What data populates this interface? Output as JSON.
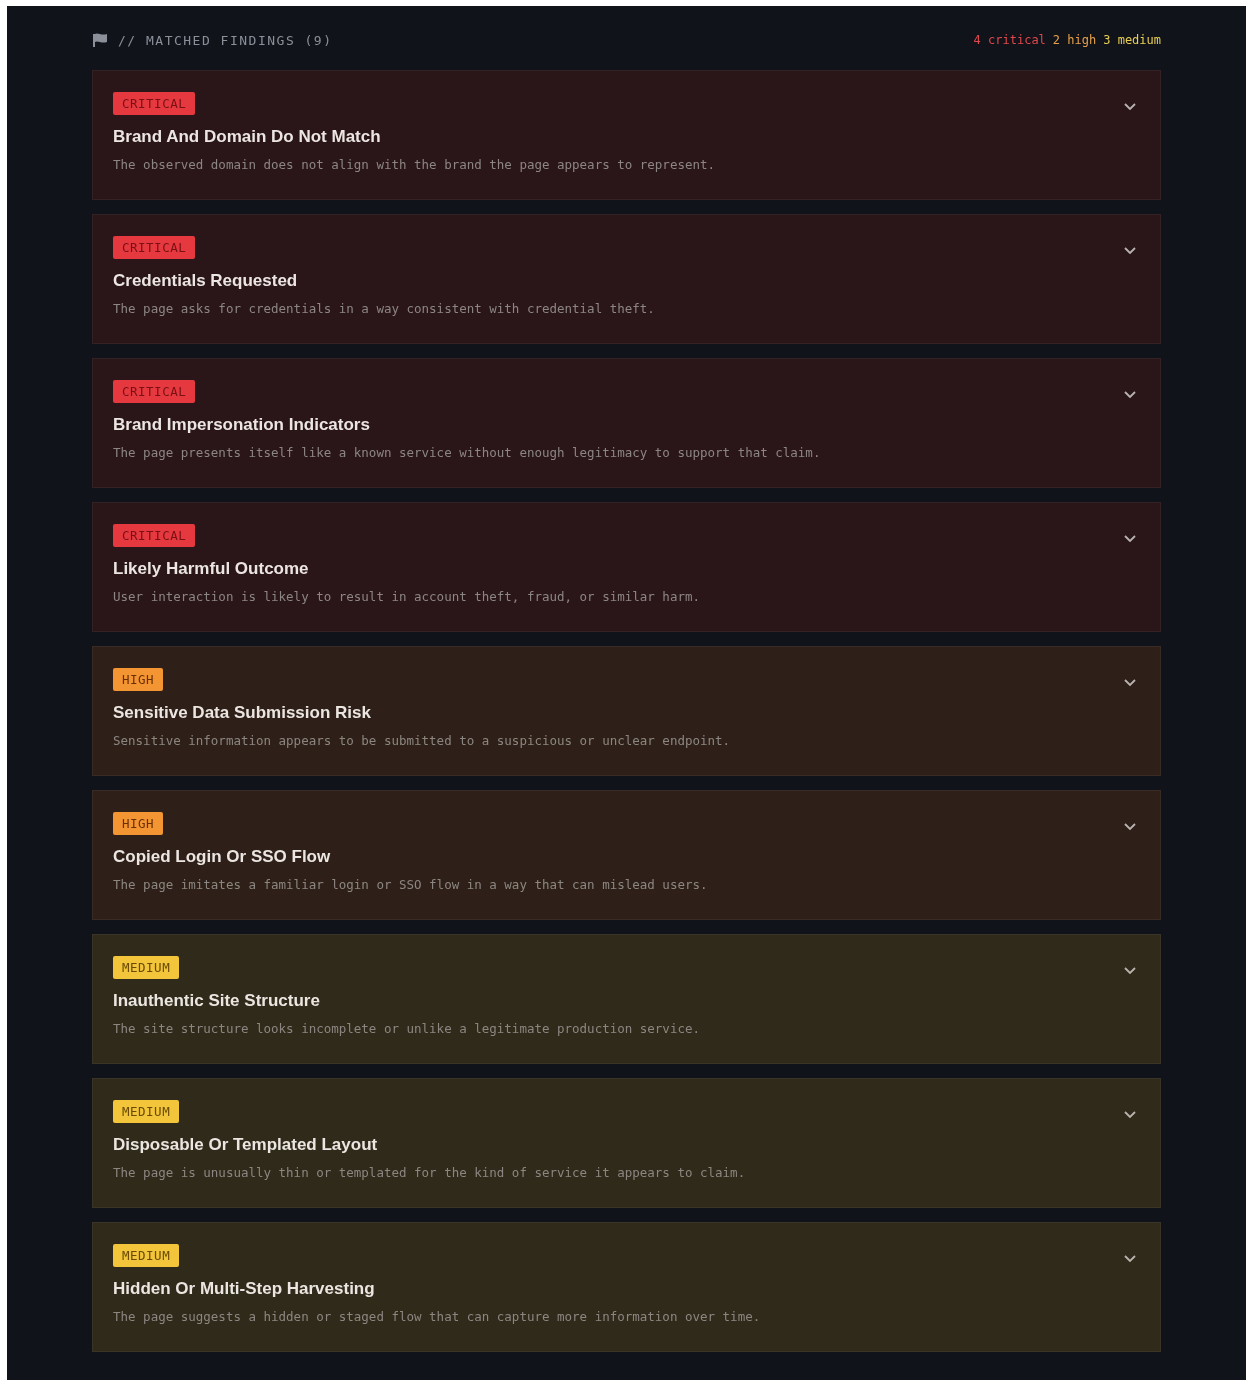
{
  "header": {
    "title": "// MATCHED FINDINGS (9)",
    "summary": [
      {
        "kind": "critical",
        "text": "4 critical"
      },
      {
        "kind": "high",
        "text": "2 high"
      },
      {
        "kind": "medium",
        "text": "3 medium"
      }
    ]
  },
  "findings": [
    {
      "kind": "critical",
      "badge": "CRITICAL",
      "title": "Brand And Domain Do Not Match",
      "description": "The observed domain does not align with the brand the page appears to represent.",
      "expanded": false
    },
    {
      "kind": "critical",
      "badge": "CRITICAL",
      "title": "Credentials Requested",
      "description": "The page asks for credentials in a way consistent with credential theft.",
      "expanded": false
    },
    {
      "kind": "critical",
      "badge": "CRITICAL",
      "title": "Brand Impersonation Indicators",
      "description": "The page presents itself like a known service without enough legitimacy to support that claim.",
      "expanded": false
    },
    {
      "kind": "critical",
      "badge": "CRITICAL",
      "title": "Likely Harmful Outcome",
      "description": "User interaction is likely to result in account theft, fraud, or similar harm.",
      "expanded": false
    },
    {
      "kind": "high",
      "badge": "HIGH",
      "title": "Sensitive Data Submission Risk",
      "description": "Sensitive information appears to be submitted to a suspicious or unclear endpoint.",
      "expanded": false
    },
    {
      "kind": "high",
      "badge": "HIGH",
      "title": "Copied Login Or SSO Flow",
      "description": "The page imitates a familiar login or SSO flow in a way that can mislead users.",
      "expanded": false
    },
    {
      "kind": "medium",
      "badge": "MEDIUM",
      "title": "Inauthentic Site Structure",
      "description": "The site structure looks incomplete or unlike a legitimate production service.",
      "expanded": false
    },
    {
      "kind": "medium",
      "badge": "MEDIUM",
      "title": "Disposable Or Templated Layout",
      "description": "The page is unusually thin or templated for the kind of service it appears to claim.",
      "expanded": false
    },
    {
      "kind": "medium",
      "badge": "MEDIUM",
      "title": "Hidden Or Multi-Step Harvesting",
      "description": "The page suggests a hidden or staged flow that can capture more information over time.",
      "expanded": false
    }
  ]
}
